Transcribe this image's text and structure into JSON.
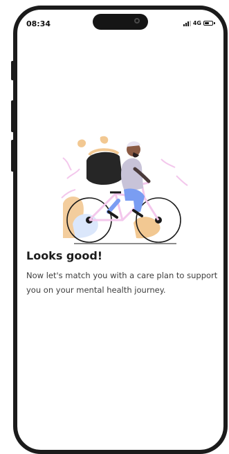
{
  "status_bar": {
    "time": "08:34",
    "network": "4G",
    "battery_level": 0.6,
    "signal_bars": 3
  },
  "screen": {
    "illustration": "person-riding-bicycle",
    "title": "Looks good!",
    "message": "Now let's match you with a care plan to support you on your mental health journey."
  },
  "colors": {
    "text_primary": "#1c1c1c",
    "text_secondary": "#3d3d3d",
    "accent_pink": "#f3c7ec",
    "accent_orange": "#f2c892",
    "accent_blue": "#7a9df2"
  }
}
